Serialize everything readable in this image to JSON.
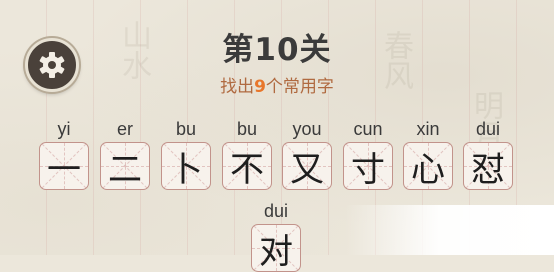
{
  "level_title": "第10关",
  "subtitle": {
    "prefix": "找出",
    "count": "9",
    "suffix": "个常用字"
  },
  "tiles": [
    {
      "pinyin": "yi",
      "char": "一"
    },
    {
      "pinyin": "er",
      "char": "二"
    },
    {
      "pinyin": "bu",
      "char": "卜"
    },
    {
      "pinyin": "bu",
      "char": "不"
    },
    {
      "pinyin": "you",
      "char": "又"
    },
    {
      "pinyin": "cun",
      "char": "寸"
    },
    {
      "pinyin": "xin",
      "char": "心"
    },
    {
      "pinyin": "dui",
      "char": "怼"
    },
    {
      "pinyin": "dui",
      "char": "对"
    }
  ],
  "icons": {
    "settings": "gear-icon"
  },
  "colors": {
    "title": "#3b3b3b",
    "subtitle": "#b06a40",
    "count_highlight": "#e8762a",
    "tile_border": "#c2938b",
    "settings_bg": "#4a413a"
  }
}
